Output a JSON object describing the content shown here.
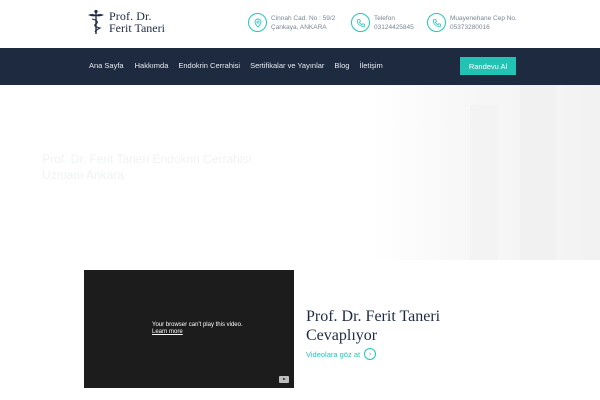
{
  "brand": {
    "line1": "Prof. Dr.",
    "line2": "Ferit Taneri",
    "icon": "caduceus-icon"
  },
  "contacts": [
    {
      "icon": "location-pin-icon",
      "line1": "Cinnah Cad. No : 59/2",
      "line2": "Çankaya, ANKARA"
    },
    {
      "icon": "phone-icon",
      "line1": "Telefon",
      "line2": "03124425845"
    },
    {
      "icon": "phone-icon",
      "line1": "Muayenehane Cep No.",
      "line2": "05373280016"
    }
  ],
  "nav": {
    "items": [
      "Ana Sayfa",
      "Hakkımda",
      "Endokrin Cerrahisi",
      "Sertifikalar ve Yayınlar",
      "Blog",
      "İletişim"
    ],
    "cta": "Randevu Al"
  },
  "hero": {
    "text": "Prof. Dr. Ferit Taneri Endokrin Cerrahisi Uzmanı Ankara"
  },
  "video": {
    "message": "Your browser can't play this video.",
    "link": "Learn more"
  },
  "section": {
    "title": "Prof. Dr. Ferit Taneri Cevaplıyor",
    "link": "Videolara göz at",
    "link_icon": "arrow-right-icon"
  },
  "colors": {
    "accent": "#22c3b4",
    "navy": "#1e2a3f",
    "text_dark": "#1e2a45"
  }
}
